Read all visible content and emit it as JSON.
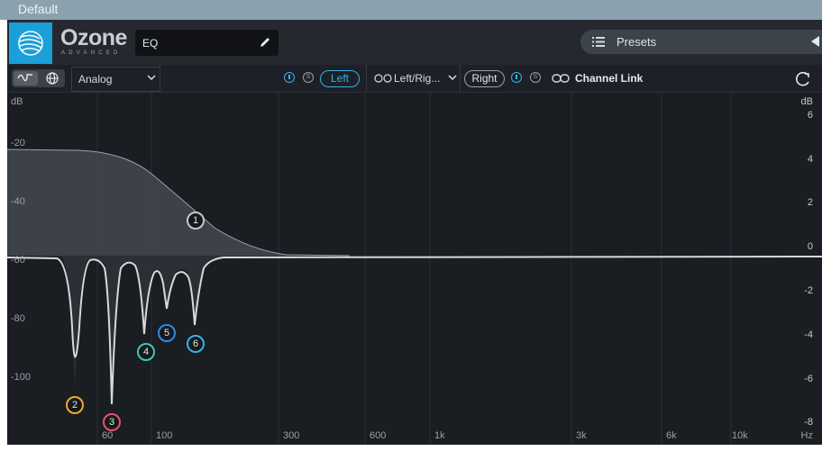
{
  "window": {
    "title": "Default"
  },
  "header": {
    "app_name": "Ozone",
    "app_edition": "ADVANCED",
    "module_name": "EQ",
    "presets_label": "Presets"
  },
  "toolbar": {
    "filter_mode": "Analog",
    "left_channel_label": "Left",
    "stereo_mode": "Left/Rig...",
    "right_channel_label": "Right",
    "solo_glyph": "S",
    "channel_link_label": "Channel Link"
  },
  "plot": {
    "left_unit": "dB",
    "right_unit": "dB",
    "freq_unit": "Hz",
    "left_db_ticks": [
      "-20",
      "-40",
      "-60",
      "-80",
      "-100"
    ],
    "right_db_ticks": [
      "6",
      "4",
      "2",
      "0",
      "-2",
      "-4",
      "-6",
      "-8"
    ],
    "freq_ticks": [
      "60",
      "100",
      "300",
      "600",
      "1k",
      "3k",
      "6k",
      "10k"
    ],
    "nodes": [
      {
        "label": "1",
        "color": "#c8c8c8"
      },
      {
        "label": "2",
        "color": "#f0a830"
      },
      {
        "label": "3",
        "color": "#e8506e"
      },
      {
        "label": "4",
        "color": "#3cc8b8"
      },
      {
        "label": "5",
        "color": "#2a8ae6"
      },
      {
        "label": "6",
        "color": "#36b4e6"
      }
    ]
  },
  "colors": {
    "accent": "#36b4e6",
    "logo_tile": "#1b9fd8",
    "panel_bg": "#1a1d22"
  }
}
